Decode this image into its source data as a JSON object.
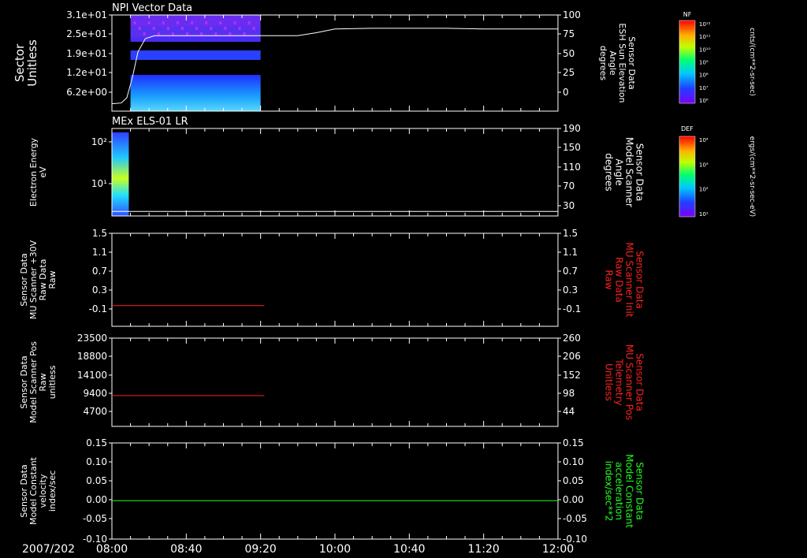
{
  "page": {
    "date_label": "2007/202"
  },
  "colors": {
    "background": "#000000",
    "axes": "#ffffff",
    "trace_white": "#ffffff",
    "trace_red": "#ff2020",
    "trace_green": "#20ff20",
    "label_red": "#ff2020",
    "label_green": "#20ff20"
  },
  "chart_data": [
    {
      "type": "heatmap",
      "title": "NPI Vector Data",
      "ylabel": [
        "Sector",
        "Unitless"
      ],
      "yticks": [
        "3.1e+01",
        "2.5e+01",
        "1.9e+01",
        "1.2e+01",
        "6.2e+00"
      ],
      "ylabel_right": [
        "Sensor Data",
        "ESH Sun Elevation",
        "Angle",
        "degrees"
      ],
      "yticks_right": [
        "100",
        "75",
        "50",
        "25",
        "0"
      ],
      "ylim_right": [
        -30,
        100
      ],
      "heatmap_x_range": [
        "08:10",
        "09:20"
      ],
      "overlay_line": {
        "name": "",
        "x": [
          "08:00",
          "08:05",
          "08:08",
          "08:11",
          "08:14",
          "08:18",
          "08:23",
          "08:40",
          "09:00",
          "09:20",
          "09:30",
          "09:40",
          "09:50",
          "10:00",
          "10:20",
          "10:40",
          "11:00",
          "11:20",
          "11:40",
          "12:00"
        ],
        "y": [
          -20,
          -19,
          -12,
          15,
          50,
          68,
          72,
          72,
          72,
          72,
          72,
          72,
          76,
          81,
          82,
          82,
          82,
          81,
          81,
          81
        ]
      },
      "colorbar": {
        "title": "NF",
        "label": "cnts/(cm**2-sr-sec)",
        "ticks": [
          "10¹²",
          "10¹¹",
          "10¹⁰",
          "10⁹",
          "10⁸",
          "10⁷",
          "10⁶"
        ]
      }
    },
    {
      "type": "heatmap",
      "title": "MEx ELS-01 LR",
      "ylabel": [
        "Electron Energy",
        "eV"
      ],
      "yticks": [
        "10²",
        "10¹"
      ],
      "ylabel_right": [
        "Sensor Data",
        "Model Scanner",
        "Angle",
        "degrees"
      ],
      "yticks_right": [
        "190",
        "150",
        "110",
        "70",
        "30"
      ],
      "ylim_right": [
        0,
        190
      ],
      "heatmap_x_range": [
        "08:00",
        "08:04"
      ],
      "overlay_line": {
        "name": "",
        "x": [
          "08:00",
          "12:00"
        ],
        "y": [
          10,
          10
        ]
      },
      "colorbar": {
        "title": "DEF",
        "label": "ergs/(cm**2-sr-sec-eV)",
        "ticks": [
          "10⁴",
          "10³",
          "10²",
          "10¹"
        ]
      }
    },
    {
      "type": "line",
      "ylabel": [
        "Sensor Data",
        "MU Scanner +30V",
        "Raw Data",
        "Raw"
      ],
      "yticks": [
        "1.5",
        "1.1",
        "0.7",
        "0.3",
        "-0.1"
      ],
      "ylim": [
        -0.3,
        1.5
      ],
      "ylabel_right": [
        "Sensor Data",
        "MU Scanner Init",
        "Raw Data",
        "Raw"
      ],
      "yticks_right": [
        "1.5",
        "1.1",
        "0.7",
        "0.3",
        "-0.1"
      ],
      "series": [
        {
          "name": "",
          "x": [
            "08:00",
            "09:22"
          ],
          "y": [
            0.1,
            0.1
          ]
        }
      ]
    },
    {
      "type": "line",
      "ylabel": [
        "Sensor Data",
        "Model Scanner Pos",
        "Raw",
        "unitless"
      ],
      "yticks": [
        "23500",
        "18800",
        "14100",
        "9400",
        "4700"
      ],
      "ylim": [
        0,
        23500
      ],
      "ylabel_right": [
        "Sensor Data",
        "MU Scanner Pos",
        "Telemetry",
        "Unitless"
      ],
      "yticks_right": [
        "260",
        "206",
        "152",
        "98",
        "44"
      ],
      "series": [
        {
          "name": "",
          "x": [
            "08:00",
            "09:22"
          ],
          "y": [
            8200,
            8200
          ]
        }
      ]
    },
    {
      "type": "line",
      "ylabel": [
        "Sensor Data",
        "Model Constant",
        "velocity",
        "index/sec"
      ],
      "yticks": [
        "0.15",
        "0.10",
        "0.05",
        "0.00",
        "-0.05",
        "-0.10"
      ],
      "ylim": [
        -0.1,
        0.15
      ],
      "ylabel_right": [
        "Sensor Data",
        "Model Constant",
        "acceleration",
        "index/sec**2"
      ],
      "yticks_right": [
        "0.15",
        "0.10",
        "0.05",
        "0.00",
        "-0.05",
        "-0.10"
      ],
      "series": [
        {
          "name": "",
          "x": [
            "08:00",
            "12:00"
          ],
          "y": [
            0.0,
            0.0
          ]
        }
      ]
    }
  ],
  "x_axis": {
    "type": "time",
    "range": [
      "08:00",
      "12:00"
    ],
    "ticks": [
      "08:00",
      "08:40",
      "09:20",
      "10:00",
      "10:40",
      "11:20",
      "12:00"
    ]
  }
}
